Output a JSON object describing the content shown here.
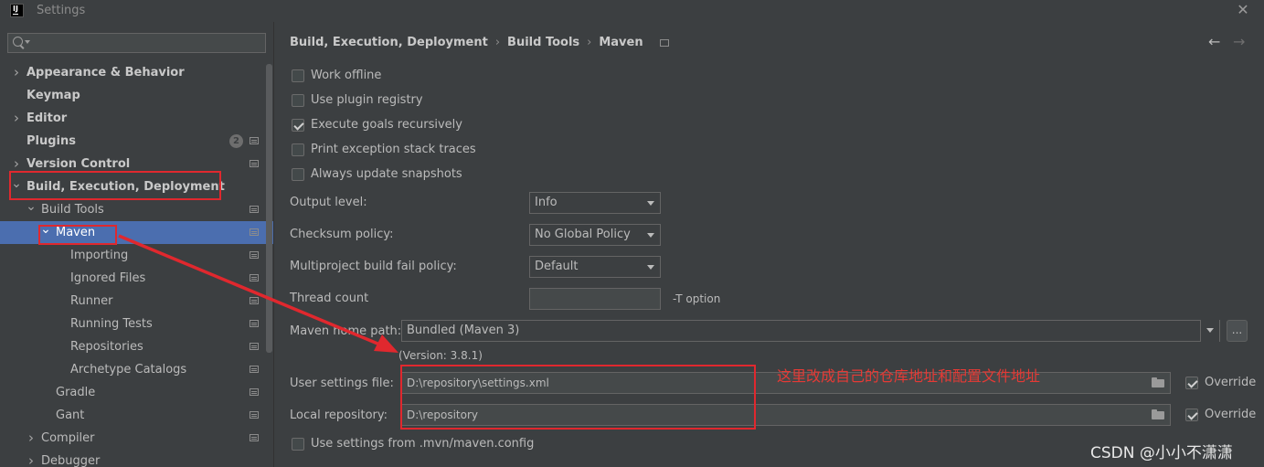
{
  "window": {
    "title": "Settings",
    "logo": "IJ"
  },
  "search": {
    "placeholder": ""
  },
  "sidebar": {
    "items": [
      {
        "label": "Appearance & Behavior",
        "level": 0,
        "chevron": "right",
        "bold": true
      },
      {
        "label": "Keymap",
        "level": 0,
        "chevron": "",
        "bold": true
      },
      {
        "label": "Editor",
        "level": 0,
        "chevron": "right",
        "bold": true
      },
      {
        "label": "Plugins",
        "level": 0,
        "chevron": "",
        "bold": true,
        "badge": "2",
        "project_icon": true
      },
      {
        "label": "Version Control",
        "level": 0,
        "chevron": "right",
        "bold": true,
        "project_icon": true
      },
      {
        "label": "Build, Execution, Deployment",
        "level": 0,
        "chevron": "down",
        "bold": true
      },
      {
        "label": "Build Tools",
        "level": 1,
        "chevron": "down",
        "bold": false,
        "project_icon": true
      },
      {
        "label": "Maven",
        "level": 2,
        "chevron": "down",
        "bold": false,
        "project_icon": true,
        "selected": true
      },
      {
        "label": "Importing",
        "level": 3,
        "chevron": "",
        "bold": false,
        "project_icon": true
      },
      {
        "label": "Ignored Files",
        "level": 3,
        "chevron": "",
        "bold": false,
        "project_icon": true
      },
      {
        "label": "Runner",
        "level": 3,
        "chevron": "",
        "bold": false,
        "project_icon": true
      },
      {
        "label": "Running Tests",
        "level": 3,
        "chevron": "",
        "bold": false,
        "project_icon": true
      },
      {
        "label": "Repositories",
        "level": 3,
        "chevron": "",
        "bold": false,
        "project_icon": true
      },
      {
        "label": "Archetype Catalogs",
        "level": 3,
        "chevron": "",
        "bold": false,
        "project_icon": true
      },
      {
        "label": "Gradle",
        "level": 2,
        "chevron": "",
        "bold": false,
        "project_icon": true
      },
      {
        "label": "Gant",
        "level": 2,
        "chevron": "",
        "bold": false,
        "project_icon": true
      },
      {
        "label": "Compiler",
        "level": 1,
        "chevron": "right",
        "bold": false,
        "project_icon": true
      },
      {
        "label": "Debugger",
        "level": 1,
        "chevron": "right",
        "bold": false
      }
    ]
  },
  "breadcrumb": [
    "Build, Execution, Deployment",
    "Build Tools",
    "Maven"
  ],
  "checkboxes": [
    {
      "label": "Work offline",
      "checked": false
    },
    {
      "label": "Use plugin registry",
      "checked": false
    },
    {
      "label": "Execute goals recursively",
      "checked": true
    },
    {
      "label": "Print exception stack traces",
      "checked": false
    },
    {
      "label": "Always update snapshots",
      "checked": false
    }
  ],
  "form": {
    "output_level_label": "Output level:",
    "output_level_value": "Info",
    "checksum_label": "Checksum policy:",
    "checksum_value": "No Global Policy",
    "multiproject_label": "Multiproject build fail policy:",
    "multiproject_value": "Default",
    "thread_count_label": "Thread count",
    "thread_count_value": "",
    "thread_count_suffix": "-T option",
    "maven_home_label": "Maven home path:",
    "maven_home_value": "Bundled (Maven 3)",
    "maven_home_browse": "...",
    "version_text": "(Version: 3.8.1)",
    "user_settings_label": "User settings file:",
    "user_settings_value": "D:\\repository\\settings.xml",
    "user_settings_override": "Override",
    "local_repo_label": "Local repository:",
    "local_repo_value": "D:\\repository",
    "local_repo_override": "Override",
    "mvn_config_label": "Use settings from .mvn/maven.config"
  },
  "annotation": {
    "text": "这里改成自己的仓库地址和配置文件地址",
    "color": "#e63a35"
  },
  "watermark": "CSDN @小小不潇潇",
  "colors": {
    "background": "#3c3f41",
    "selection": "#4b6eaf",
    "highlight_red": "#e0282e",
    "text": "#bbbbbb"
  }
}
